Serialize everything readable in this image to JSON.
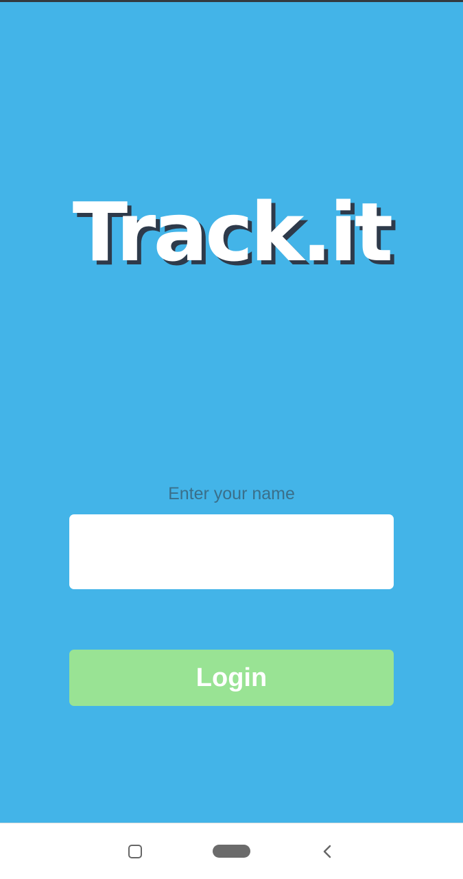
{
  "app": {
    "title": "Track.it"
  },
  "login_form": {
    "name_label": "Enter your name",
    "name_value": "",
    "name_placeholder": "",
    "login_label": "Login"
  },
  "navigation_bar": {
    "recent_icon": "square-icon",
    "home_icon": "home-pill-icon",
    "back_icon": "chevron-left-icon"
  },
  "colors": {
    "background": "#43b4e8",
    "login_button": "#99e394",
    "logo_shadow": "#2e3a4a",
    "label_text": "#3a6f8a"
  }
}
